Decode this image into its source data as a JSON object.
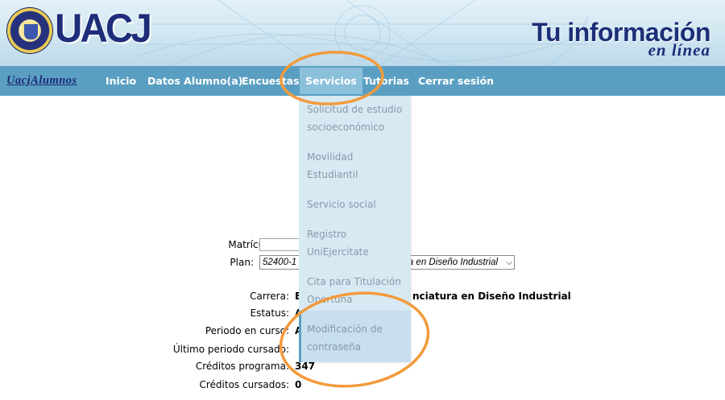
{
  "header": {
    "logo_text": "UACJ",
    "tagline_main": "Tu información",
    "tagline_sub": "en línea"
  },
  "nav": {
    "brand": "UacjAlumnos",
    "items": [
      "Inicio",
      "Datos Alumno(a)",
      "Encuestas",
      "Servicios",
      "Tutorias",
      "Cerrar sesión"
    ],
    "active": "Servicios"
  },
  "dropdown": {
    "items": [
      [
        "Solicitud de estudio",
        "socioeconómico"
      ],
      [
        "Movilidad",
        "Estudiantil"
      ],
      [
        "Servicio social"
      ],
      [
        "Registro",
        "UniEjercitate"
      ],
      [
        "Cita para Titulación",
        "Oportuna"
      ],
      [
        "Modificación de",
        "contraseña"
      ]
    ],
    "highlighted": "Modificación de contraseña"
  },
  "form": {
    "matricula_label": "Matrícula:",
    "matricula_value": "",
    "plan_label": "Plan:",
    "plan_prefix": "52400-1",
    "plan_suffix": "ra en Diseño Industrial",
    "carrera_label": "Carrera:",
    "carrera_value_prefix": "E",
    "carrera_value_suffix": "nciatura en Diseño Industrial",
    "estatus_label": "Estatus:",
    "estatus_value": "A",
    "periodo_label": "Periodo en curso:",
    "periodo_value": "A",
    "ultimo_label": "Último periodo cursado:",
    "creditos_programa_label": "Créditos programa:",
    "creditos_programa_value": "347",
    "creditos_cursados_label": "Créditos cursados:",
    "creditos_cursados_value": "0"
  },
  "colors": {
    "nav_bg": "#5a9fc2",
    "nav_active": "#8bc0da",
    "dropdown_bg": "#d7e9f3",
    "annotation": "#f39a3b",
    "brand_blue": "#1e2d7a"
  }
}
